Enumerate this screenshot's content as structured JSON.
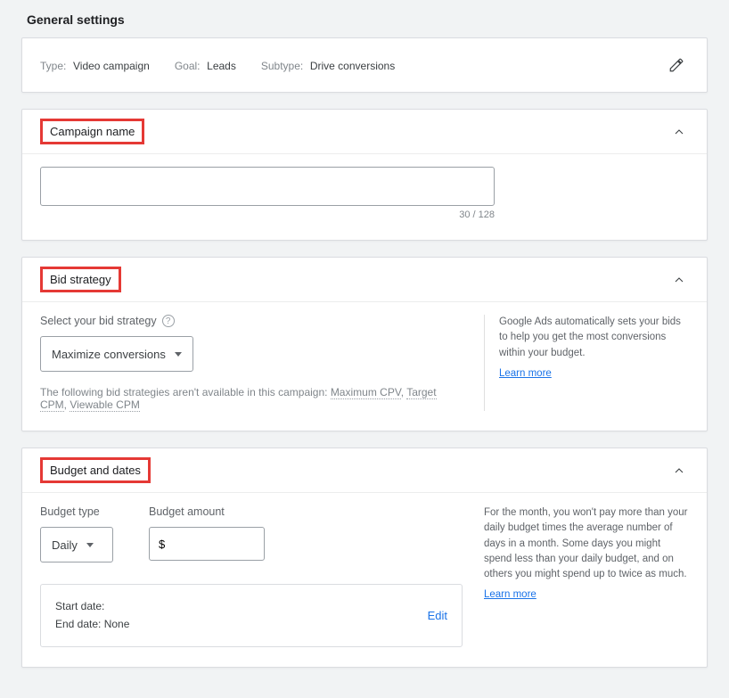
{
  "page": {
    "title": "General settings"
  },
  "summary": {
    "typeLabel": "Type:",
    "typeValue": "Video campaign",
    "goalLabel": "Goal:",
    "goalValue": "Leads",
    "subtypeLabel": "Subtype:",
    "subtypeValue": "Drive conversions"
  },
  "campaignName": {
    "sectionTitle": "Campaign name",
    "value": "",
    "charCount": "30 / 128"
  },
  "bidStrategy": {
    "sectionTitle": "Bid strategy",
    "selectLabel": "Select your bid strategy",
    "selected": "Maximize conversions",
    "notePrefix": "The following bid strategies aren't available in this campaign: ",
    "unavailable1": "Maximum CPV",
    "unavailable2": "Target CPM",
    "unavailable3": "Viewable CPM",
    "sep": ", ",
    "helpText": "Google Ads automatically sets your bids to help you get the most conversions within your budget.",
    "learnMore": "Learn more"
  },
  "budget": {
    "sectionTitle": "Budget and dates",
    "budgetTypeLabel": "Budget type",
    "budgetTypeValue": "Daily",
    "budgetAmountLabel": "Budget amount",
    "budgetAmountValue": "$",
    "helpText": "For the month, you won't pay more than your daily budget times the average number of days in a month. Some days you might spend less than your daily budget, and on others you might spend up to twice as much.",
    "learnMore": "Learn more",
    "startDateLabel": "Start date:",
    "endDateLabel": "End date: ",
    "endDateValue": "None",
    "editLabel": "Edit"
  }
}
